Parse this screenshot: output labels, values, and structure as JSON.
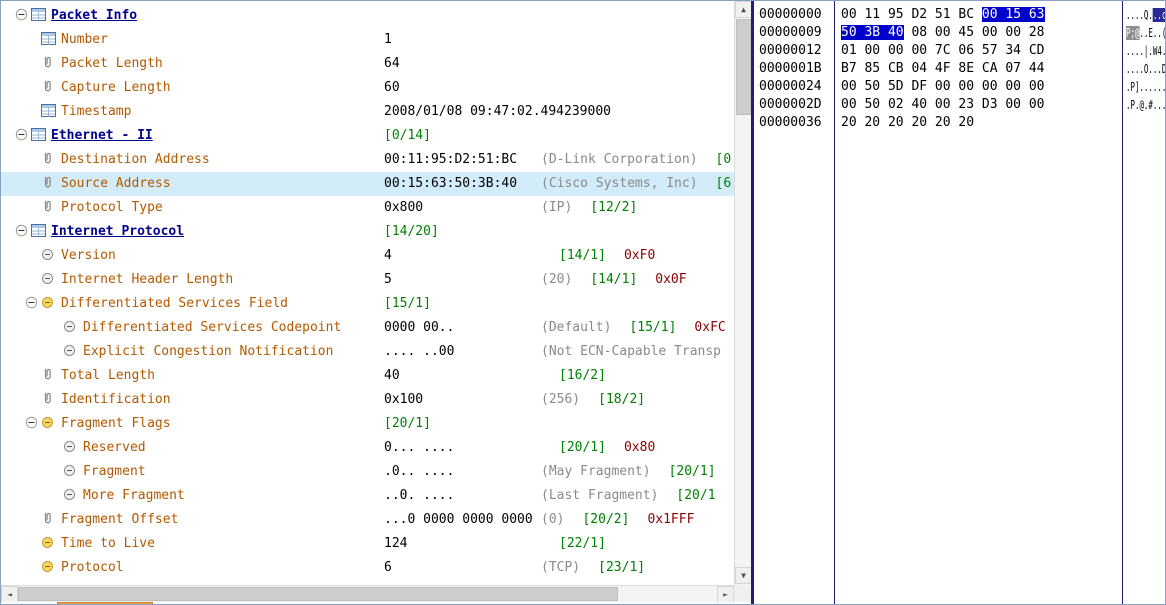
{
  "ui": {
    "selection_hex_bg": "#0000cc",
    "selected_row_bg": "#d2ecf9",
    "label_color": "#b35900",
    "header_color": "#00008b",
    "range_color": "#008000",
    "note_color": "#8a8a8a",
    "mask_color": "#8b0000",
    "tab_color": "#f0a14f"
  },
  "tree": {
    "rows": [
      {
        "lvl": 0,
        "exp": true,
        "icon": "sheet",
        "hdr": true,
        "label": "Packet Info",
        "segs": []
      },
      {
        "lvl": 1,
        "icon": "sheet",
        "label": "Number",
        "segs": [
          {
            "t": "1",
            "c": "value"
          }
        ]
      },
      {
        "lvl": 1,
        "icon": "clip",
        "label": "Packet Length",
        "segs": [
          {
            "t": "64",
            "c": "value"
          }
        ]
      },
      {
        "lvl": 1,
        "icon": "clip",
        "label": "Capture Length",
        "segs": [
          {
            "t": "60",
            "c": "value"
          }
        ]
      },
      {
        "lvl": 1,
        "icon": "sheet",
        "label": "Timestamp",
        "segs": [
          {
            "t": "2008/01/08 09:47:02.494239000",
            "c": "value"
          }
        ]
      },
      {
        "lvl": 0,
        "exp": true,
        "icon": "sheet",
        "hdr": true,
        "label": "Ethernet - II",
        "segs": [
          {
            "t": "[0/14]",
            "c": "range"
          }
        ]
      },
      {
        "lvl": 1,
        "icon": "clip",
        "label": "Destination Address",
        "segs": [
          {
            "t": "00:11:95:D2:51:BC",
            "c": "value"
          },
          {
            "t": "(D-Link Corporation)",
            "c": "note"
          },
          {
            "t": "[0",
            "c": "range"
          }
        ]
      },
      {
        "lvl": 1,
        "icon": "clip",
        "label": "Source Address",
        "sel": true,
        "segs": [
          {
            "t": "00:15:63:50:3B:40",
            "c": "value"
          },
          {
            "t": "(Cisco Systems, Inc)",
            "c": "note"
          },
          {
            "t": "[6",
            "c": "range"
          }
        ]
      },
      {
        "lvl": 1,
        "icon": "clip",
        "label": "Protocol Type",
        "segs": [
          {
            "t": "0x800",
            "c": "value"
          },
          {
            "t": "(IP)",
            "c": "note"
          },
          {
            "t": "[12/2]",
            "c": "range"
          }
        ]
      },
      {
        "lvl": 0,
        "exp": true,
        "icon": "sheet",
        "hdr": true,
        "label": "Internet Protocol",
        "segs": [
          {
            "t": "[14/20]",
            "c": "range"
          }
        ]
      },
      {
        "lvl": 1,
        "icon": "dotg",
        "label": "Version",
        "segs": [
          {
            "t": "4",
            "c": "value"
          },
          {
            "t": "[14/1]",
            "c": "range"
          },
          {
            "t": "0xF0",
            "c": "mask"
          }
        ]
      },
      {
        "lvl": 1,
        "icon": "dotg",
        "label": "Internet Header Length",
        "segs": [
          {
            "t": "5",
            "c": "value"
          },
          {
            "t": "(20)",
            "c": "note"
          },
          {
            "t": "[14/1]",
            "c": "range"
          },
          {
            "t": "0x0F",
            "c": "mask"
          }
        ]
      },
      {
        "lvl": 1,
        "exp": true,
        "icon": "doty",
        "label": "Differentiated Services Field",
        "segs": [
          {
            "t": "[15/1]",
            "c": "range"
          }
        ]
      },
      {
        "lvl": 2,
        "icon": "dotg",
        "label": "Differentiated Services Codepoint",
        "segs": [
          {
            "t": "0000 00..",
            "c": "value"
          },
          {
            "t": "(Default)",
            "c": "note"
          },
          {
            "t": "[15/1]",
            "c": "range"
          },
          {
            "t": "0xFC",
            "c": "mask"
          }
        ]
      },
      {
        "lvl": 2,
        "icon": "dotg",
        "label": "Explicit Congestion Notification",
        "segs": [
          {
            "t": ".... ..00",
            "c": "value"
          },
          {
            "t": "(Not ECN-Capable Transp",
            "c": "note"
          }
        ]
      },
      {
        "lvl": 1,
        "icon": "clip",
        "label": "Total Length",
        "segs": [
          {
            "t": "40",
            "c": "value"
          },
          {
            "t": "[16/2]",
            "c": "range"
          }
        ]
      },
      {
        "lvl": 1,
        "icon": "clip",
        "label": "Identification",
        "segs": [
          {
            "t": "0x100",
            "c": "value"
          },
          {
            "t": "(256)",
            "c": "note"
          },
          {
            "t": "[18/2]",
            "c": "range"
          }
        ]
      },
      {
        "lvl": 1,
        "exp": true,
        "icon": "doty",
        "label": "Fragment Flags",
        "segs": [
          {
            "t": "[20/1]",
            "c": "range"
          }
        ]
      },
      {
        "lvl": 2,
        "icon": "dotg",
        "label": "Reserved",
        "segs": [
          {
            "t": "0... ....",
            "c": "value"
          },
          {
            "t": "[20/1]",
            "c": "range"
          },
          {
            "t": "0x80",
            "c": "mask"
          }
        ]
      },
      {
        "lvl": 2,
        "icon": "dotg",
        "label": "Fragment",
        "segs": [
          {
            "t": ".0.. ....",
            "c": "value"
          },
          {
            "t": "(May Fragment)",
            "c": "note"
          },
          {
            "t": "[20/1]",
            "c": "range"
          }
        ]
      },
      {
        "lvl": 2,
        "icon": "dotg",
        "label": "More Fragment",
        "segs": [
          {
            "t": "..0. ....",
            "c": "value"
          },
          {
            "t": "(Last Fragment)",
            "c": "note"
          },
          {
            "t": "[20/1",
            "c": "range"
          }
        ]
      },
      {
        "lvl": 1,
        "icon": "clip",
        "label": "Fragment Offset",
        "segs": [
          {
            "t": "...0 0000 0000 0000",
            "c": "value"
          },
          {
            "t": "(0)",
            "c": "note"
          },
          {
            "t": "[20/2]",
            "c": "range"
          },
          {
            "t": "0x1FFF",
            "c": "mask"
          }
        ]
      },
      {
        "lvl": 1,
        "icon": "doty",
        "label": "Time to Live",
        "segs": [
          {
            "t": "124",
            "c": "value"
          },
          {
            "t": "[22/1]",
            "c": "range"
          }
        ]
      },
      {
        "lvl": 1,
        "icon": "doty",
        "label": "Protocol",
        "segs": [
          {
            "t": "6",
            "c": "value"
          },
          {
            "t": "(TCP)",
            "c": "note"
          },
          {
            "t": "[23/1]",
            "c": "range"
          }
        ]
      }
    ]
  },
  "hex": {
    "rows": [
      {
        "offset": "00000000",
        "bytes": [
          "00",
          "11",
          "95",
          "D2",
          "51",
          "BC",
          "00",
          "15",
          "63"
        ],
        "sel": [
          6,
          9
        ],
        "ascii": "....Q...c",
        "asel_bg": "#2a2a96"
      },
      {
        "offset": "00000009",
        "bytes": [
          "50",
          "3B",
          "40",
          "08",
          "00",
          "45",
          "00",
          "00",
          "28"
        ],
        "sel": [
          0,
          3
        ],
        "ascii": "P;@..E..(",
        "asel_bg": "#8e8e8e"
      },
      {
        "offset": "00000012",
        "bytes": [
          "01",
          "00",
          "00",
          "00",
          "7C",
          "06",
          "57",
          "34",
          "CD"
        ],
        "ascii": "....|.W4."
      },
      {
        "offset": "0000001B",
        "bytes": [
          "B7",
          "85",
          "CB",
          "04",
          "4F",
          "8E",
          "CA",
          "07",
          "44"
        ],
        "ascii": "....O...D"
      },
      {
        "offset": "00000024",
        "bytes": [
          "00",
          "50",
          "5D",
          "DF",
          "00",
          "00",
          "00",
          "00",
          "00"
        ],
        "ascii": ".P]......"
      },
      {
        "offset": "0000002D",
        "bytes": [
          "00",
          "50",
          "02",
          "40",
          "00",
          "23",
          "D3",
          "00",
          "00"
        ],
        "ascii": ".P.@.#..."
      },
      {
        "offset": "00000036",
        "bytes": [
          "20",
          "20",
          "20",
          "20",
          "20",
          "20"
        ],
        "ascii": "      "
      }
    ]
  },
  "scrollbar": {
    "up": "▲",
    "down": "▼",
    "left": "◄",
    "right": "►"
  }
}
